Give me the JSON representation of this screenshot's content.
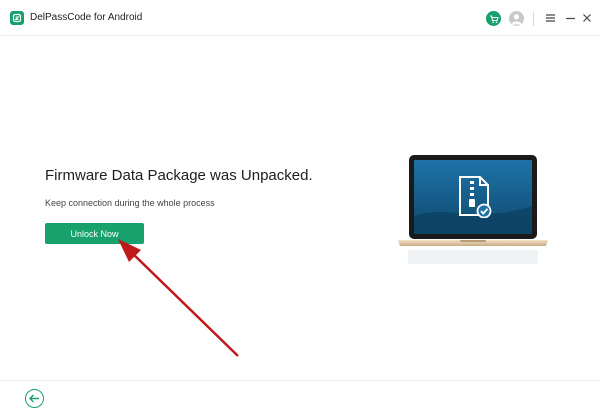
{
  "titlebar": {
    "app_title": "DelPassCode for Android",
    "icons": [
      "app-logo-icon",
      "cart-icon",
      "user-avatar-icon",
      "menu-icon",
      "minimize-icon",
      "close-icon"
    ]
  },
  "main": {
    "heading": "Firmware Data Package was Unpacked.",
    "subtext": "Keep connection during the whole process",
    "unlock_button_label": "Unlock Now"
  },
  "illustration": {
    "description_icon": "zip-file-check-icon"
  },
  "footer": {
    "back_icon": "back-arrow-icon"
  },
  "colors": {
    "accent": "#18a06d",
    "arrow": "#c0191c",
    "screen_top": "#1e72a8",
    "screen_bottom": "#0e4a6e"
  }
}
